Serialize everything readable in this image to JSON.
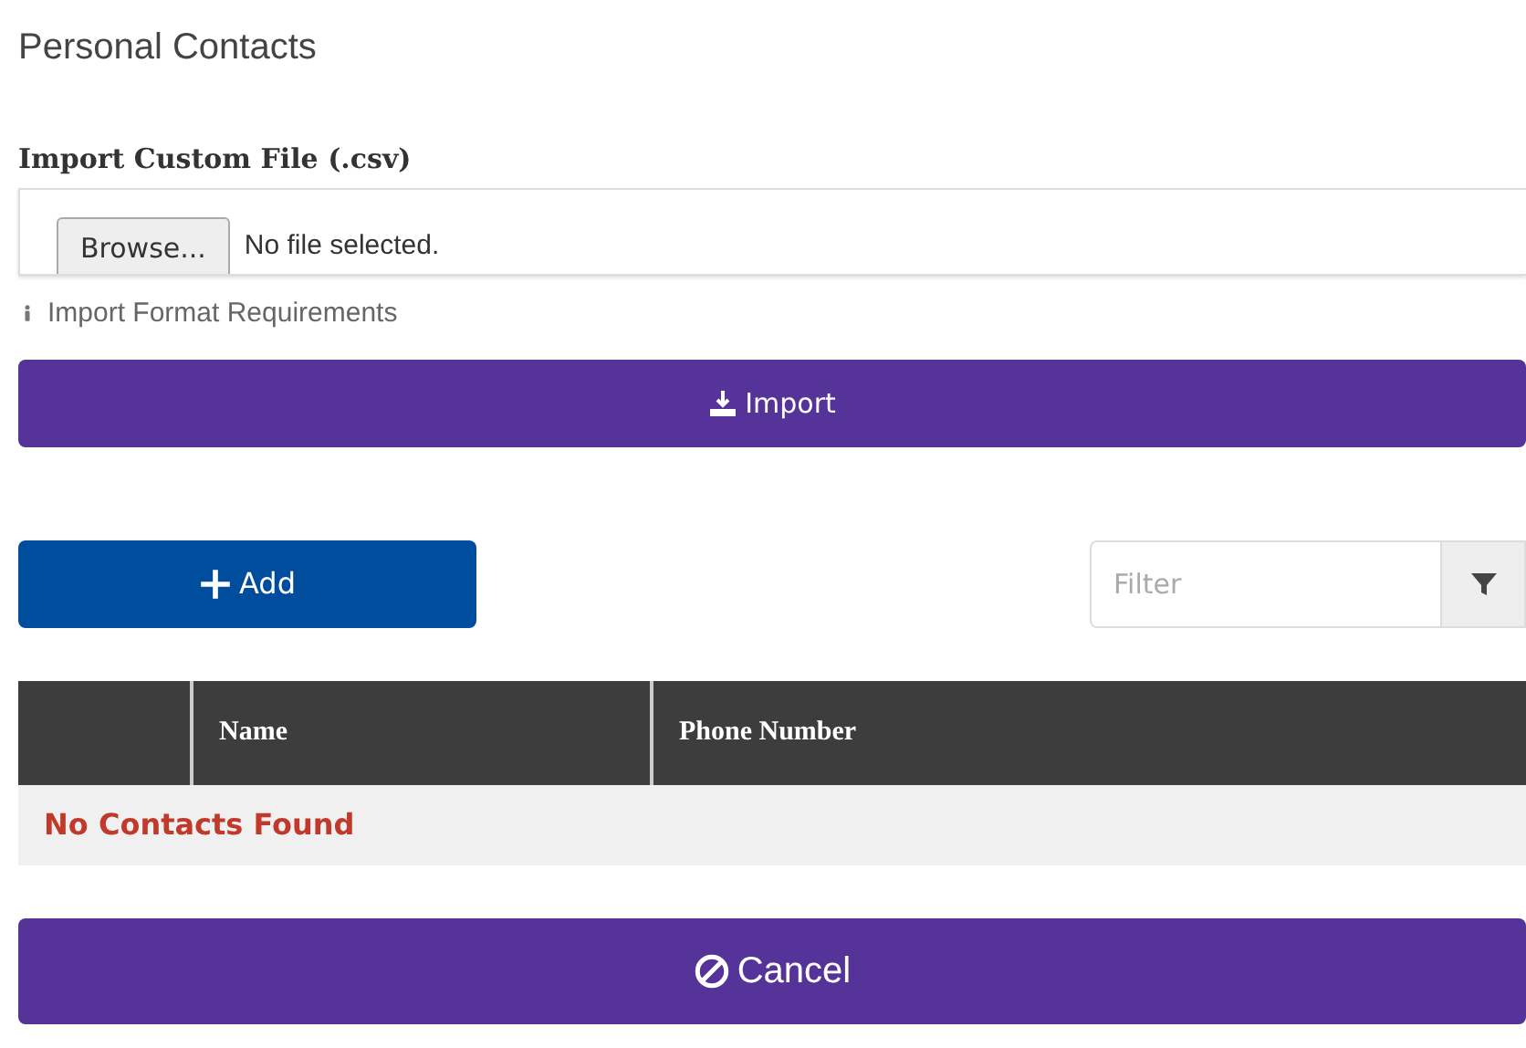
{
  "title": "Personal Contacts",
  "import": {
    "label": "Import Custom File (.csv)",
    "browse": "Browse...",
    "file_status": "No file selected.",
    "requirements_link": "Import Format Requirements",
    "button": "Import"
  },
  "add_button": "Add",
  "filter": {
    "placeholder": "Filter"
  },
  "table": {
    "columns": [
      "",
      "Name",
      "Phone Number"
    ],
    "empty_message": "No Contacts Found"
  },
  "cancel_button": "Cancel"
}
